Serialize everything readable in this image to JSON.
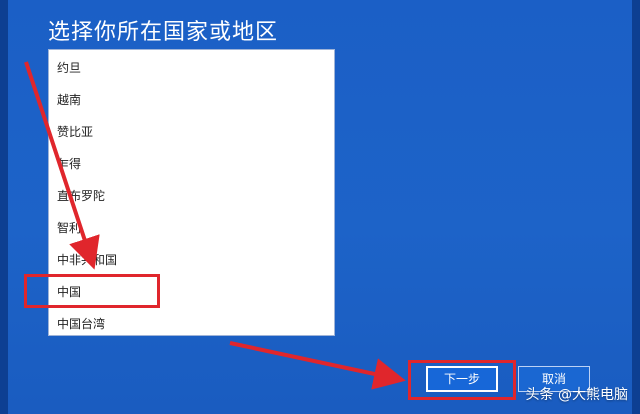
{
  "dialog": {
    "title": "选择你所在国家或地区"
  },
  "list": {
    "items": [
      {
        "label": "约旦"
      },
      {
        "label": "越南"
      },
      {
        "label": "赞比亚"
      },
      {
        "label": "乍得"
      },
      {
        "label": "直布罗陀"
      },
      {
        "label": "智利"
      },
      {
        "label": "中非共和国"
      },
      {
        "label": "中国"
      },
      {
        "label": "中国台湾"
      }
    ],
    "selected": "中国"
  },
  "buttons": {
    "next_label": "下一步",
    "cancel_label": "取消"
  },
  "watermark": {
    "text": "头条 @大熊电脑"
  },
  "colors": {
    "background": "#1d63c8",
    "annotation_red": "#e0262c",
    "list_bg": "#ffffff"
  }
}
